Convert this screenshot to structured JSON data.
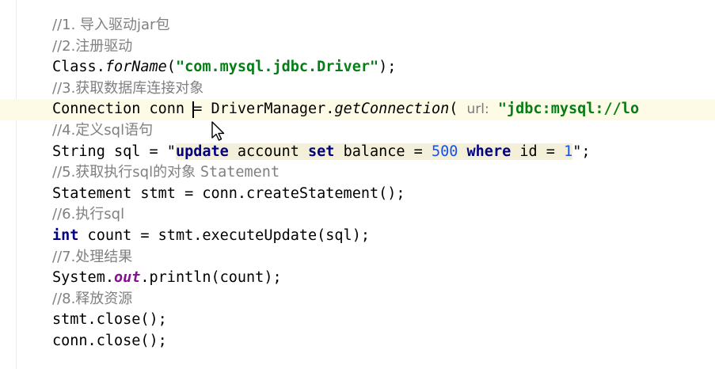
{
  "editor": {
    "lines": [
      {
        "comment": "//1. 导入驱动jar包"
      },
      {
        "comment": "//2.注册驱动"
      },
      {
        "class": "Class.",
        "method": "forName",
        "open": "(",
        "string": "\"com.mysql.jdbc.Driver\"",
        "close": ");"
      },
      {
        "comment": "//3.获取数据库连接对象"
      },
      {
        "type": "Connection conn ",
        "eq": "= DriverManager.",
        "method": "getConnection",
        "open": "( ",
        "hint": "url:",
        "string": " \"jdbc:mysql://lo"
      },
      {
        "comment": "//4.定义sql语句"
      },
      {
        "pre": "String sql = \"",
        "kw1": "update",
        "t1": " account ",
        "kw2": "set",
        "t2": " balance = ",
        "num1": "500",
        "t3": " ",
        "kw3": "where",
        "t4": " id = ",
        "num2": "1",
        "post": "\";"
      },
      {
        "comment": "//5.获取执行sql的对象 ",
        "comment_mono": "Statement"
      },
      {
        "text": "Statement stmt = conn.createStatement();"
      },
      {
        "comment": "//6.执行sql"
      },
      {
        "kw": "int",
        "text": " count = stmt.executeUpdate(sql);"
      },
      {
        "comment": "//7.处理结果"
      },
      {
        "pre": "System.",
        "field": "out",
        "post": ".println(count);"
      },
      {
        "comment": "//8.释放资源"
      },
      {
        "text": "stmt.close();"
      },
      {
        "text": "conn.close();"
      }
    ]
  }
}
